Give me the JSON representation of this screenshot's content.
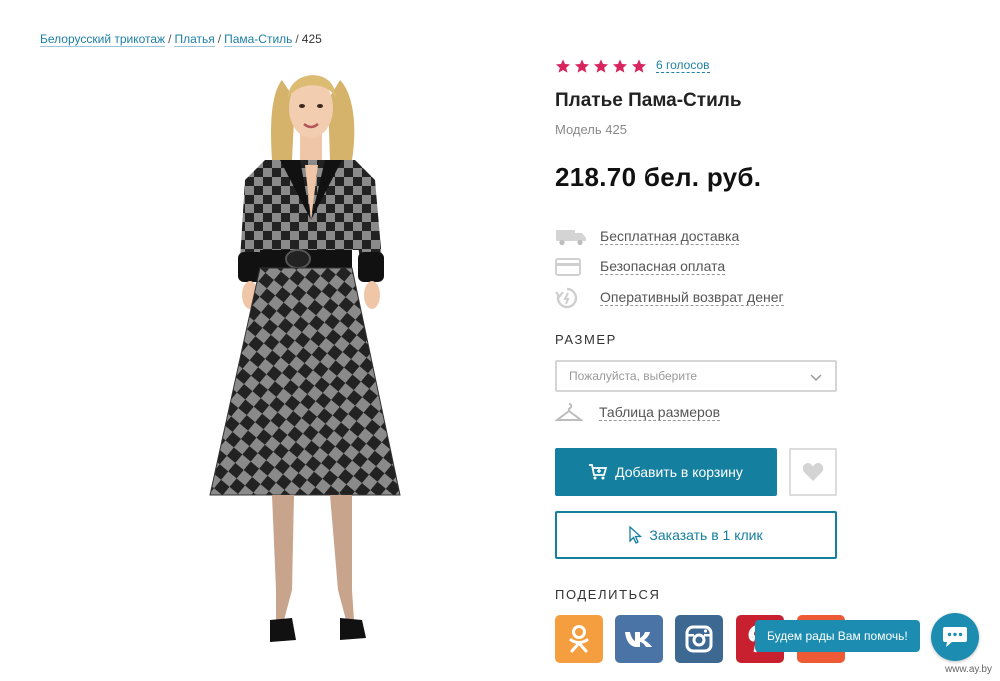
{
  "breadcrumb": {
    "items": [
      "Белорусский трикотаж",
      "Платья",
      "Пама-Стиль"
    ],
    "current": "425",
    "separator": "/"
  },
  "rating": {
    "stars": 5,
    "max_stars": 5,
    "votes_label": "6 голосов",
    "star_color": "#d8255e"
  },
  "product": {
    "title": "Платье Пама-Стиль",
    "model": "Модель 425",
    "price": "218.70 бел. руб."
  },
  "features": [
    {
      "icon": "truck-icon",
      "label": "Бесплатная доставка"
    },
    {
      "icon": "card-icon",
      "label": "Безопасная оплата"
    },
    {
      "icon": "refund-icon",
      "label": "Оперативный возврат денег"
    }
  ],
  "size": {
    "label": "РАЗМЕР",
    "placeholder": "Пожалуйста, выберите",
    "table_link": "Таблица размеров"
  },
  "actions": {
    "add_to_cart": "Добавить в корзину",
    "one_click": "Заказать в 1 клик"
  },
  "share": {
    "label": "ПОДЕЛИТЬСЯ",
    "networks": [
      "odnoklassniki",
      "vkontakte",
      "instagram",
      "pinterest",
      "mail"
    ]
  },
  "chat": {
    "bubble": "Будем рады Вам помочь!"
  },
  "watermark": "www.ay.by",
  "colors": {
    "accent": "#157f9f",
    "link": "#1f7fa6",
    "chat": "#1c8db0"
  }
}
